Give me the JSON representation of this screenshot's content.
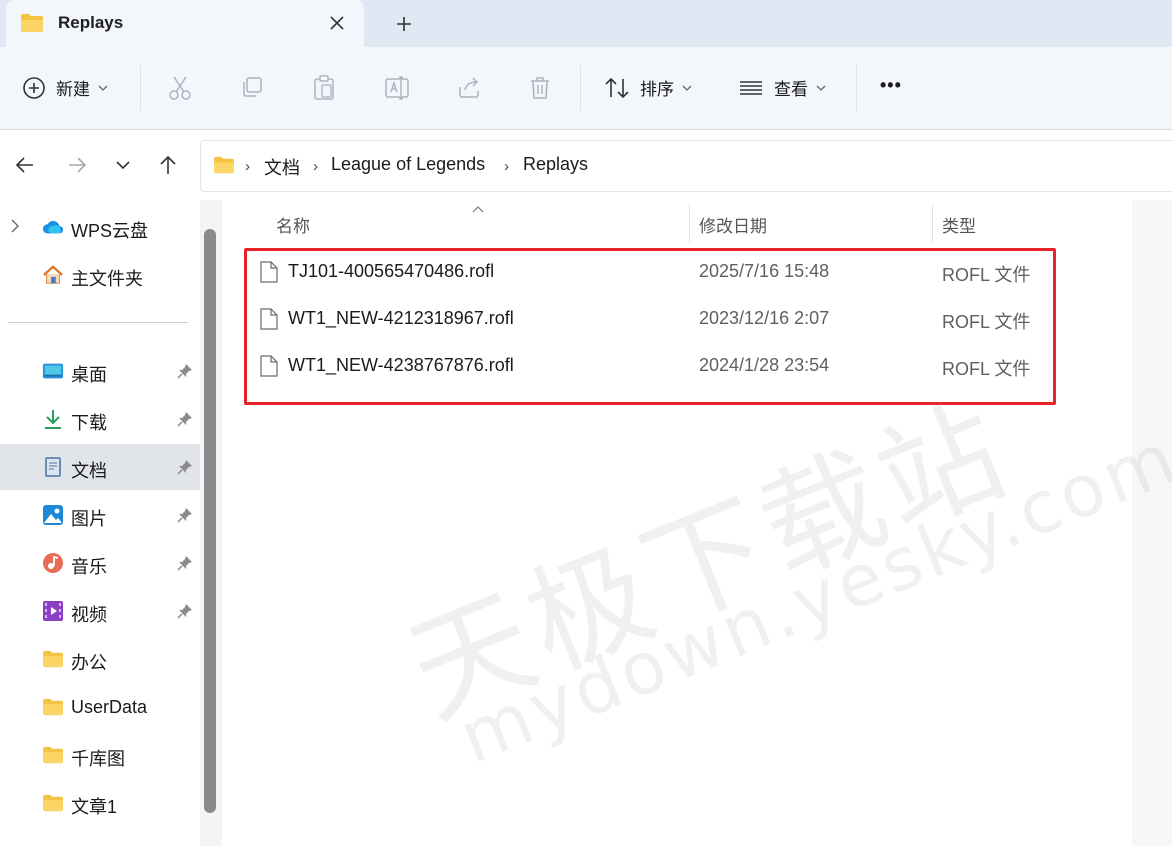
{
  "window": {
    "tab_title": "Replays",
    "close_symbol": "✕",
    "new_tab_symbol": "+"
  },
  "toolbar": {
    "new_label": "新建",
    "sort_label": "排序",
    "view_label": "查看",
    "more_label": "•••"
  },
  "breadcrumb": [
    "文档",
    "League of Legends",
    "Replays"
  ],
  "sidebar": {
    "top_items": [
      {
        "label": "WPS云盘",
        "icon": "cloud-icon"
      },
      {
        "label": "主文件夹",
        "icon": "home-icon"
      }
    ],
    "pinned_items": [
      {
        "label": "桌面",
        "icon": "desktop-icon"
      },
      {
        "label": "下载",
        "icon": "download-icon"
      },
      {
        "label": "文档",
        "icon": "documents-icon"
      },
      {
        "label": "图片",
        "icon": "pictures-icon"
      },
      {
        "label": "音乐",
        "icon": "music-icon"
      },
      {
        "label": "视频",
        "icon": "videos-icon"
      }
    ],
    "folders": [
      {
        "label": "办公"
      },
      {
        "label": "UserData"
      },
      {
        "label": "千库图"
      },
      {
        "label": "文章1"
      }
    ],
    "selected": "文档"
  },
  "columns": {
    "name": "名称",
    "date": "修改日期",
    "type": "类型"
  },
  "files": [
    {
      "name": "TJ101-400565470486.rofl",
      "date": "2025/7/16 15:48",
      "type": "ROFL 文件"
    },
    {
      "name": "WT1_NEW-4212318967.rofl",
      "date": "2023/12/16 2:07",
      "type": "ROFL 文件"
    },
    {
      "name": "WT1_NEW-4238767876.rofl",
      "date": "2024/1/28 23:54",
      "type": "ROFL 文件"
    }
  ],
  "watermark": {
    "line1": "天极下载站",
    "line2": "mydown.yesky.com"
  },
  "colors": {
    "highlight": "#e8242a",
    "folder": "#f5c342",
    "accent": "#0a64c8"
  }
}
